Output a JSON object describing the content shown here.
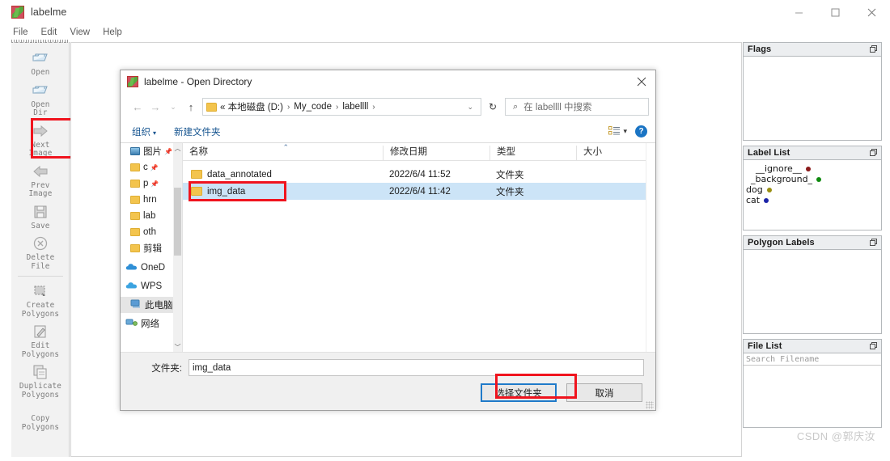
{
  "app": {
    "title": "labelme",
    "window_controls": [
      "minimize",
      "maximize",
      "close"
    ]
  },
  "menubar": {
    "items": [
      "File",
      "Edit",
      "View",
      "Help"
    ]
  },
  "toolbar": {
    "items": [
      {
        "label": "Open",
        "icon": "open-folder-icon"
      },
      {
        "label": "Open\nDir",
        "icon": "open-dir-folder-icon",
        "highlighted": true
      },
      {
        "label": "Next\nImage",
        "icon": "right-arrow-icon"
      },
      {
        "label": "Prev\nImage",
        "icon": "left-arrow-icon"
      },
      {
        "label": "Save",
        "icon": "floppy-disk-icon"
      },
      {
        "label": "Delete\nFile",
        "icon": "circle-x-icon"
      },
      {
        "label": "Create\nPolygons",
        "icon": "create-polygon-icon"
      },
      {
        "label": "Edit\nPolygons",
        "icon": "edit-polygon-icon"
      },
      {
        "label": "Duplicate\nPolygons",
        "icon": "duplicate-polygon-icon"
      },
      {
        "label": "Copy\nPolygons",
        "icon": "copy-polygon-icon"
      }
    ]
  },
  "dock": {
    "flags": {
      "title": "Flags",
      "float_icon": "float-panel-icon"
    },
    "label_list": {
      "title": "Label List",
      "float_icon": "float-panel-icon",
      "items": [
        {
          "text": "__ignore__",
          "color": "#8b1a1a"
        },
        {
          "text": "_background_",
          "color": "#0f8a0f"
        },
        {
          "text": "dog",
          "color": "#9a8f12"
        },
        {
          "text": "cat",
          "color": "#1b23a8"
        }
      ]
    },
    "polygon_labels": {
      "title": "Polygon Labels",
      "float_icon": "float-panel-icon"
    },
    "file_list": {
      "title": "File List",
      "float_icon": "float-panel-icon",
      "search_placeholder": "Search Filename"
    }
  },
  "watermark": "CSDN @郭庆汝",
  "dialog": {
    "title": "labelme - Open Directory",
    "close_icon": "close-icon",
    "nav": {
      "back_icon": "back-arrow-icon",
      "forward_icon": "forward-arrow-icon",
      "recent_icon": "chevron-down-icon",
      "up_icon": "up-arrow-icon",
      "refresh_icon": "refresh-icon",
      "breadcrumb": [
        "« 本地磁盘 (D:)",
        "My_code",
        "labellll",
        ""
      ],
      "breadcrumb_caret": "chevron-down-icon",
      "search_icon": "search-icon",
      "search_placeholder": "在 labellll 中搜索"
    },
    "commandbar": {
      "organize": "组织",
      "new_folder": "新建文件夹",
      "view_icon": "view-mode-icon",
      "view_caret": "chevron-down-icon",
      "help_icon": "help-icon",
      "help_label": "?"
    },
    "navpane": {
      "items": [
        {
          "label": "图片",
          "icon": "pictures-icon",
          "pinned": true
        },
        {
          "label": "c",
          "icon": "folder-icon",
          "pinned": true
        },
        {
          "label": "p",
          "icon": "folder-icon",
          "pinned": true
        },
        {
          "label": "hrn",
          "icon": "folder-icon",
          "pinned": false
        },
        {
          "label": "lab",
          "icon": "folder-icon",
          "pinned": false
        },
        {
          "label": "oth",
          "icon": "folder-icon",
          "pinned": false
        },
        {
          "label": "剪辑",
          "icon": "folder-icon",
          "pinned": false
        },
        {
          "label": "OneD",
          "icon": "onedrive-cloud-icon",
          "pinned": false
        },
        {
          "label": "WPS",
          "icon": "wps-cloud-icon",
          "pinned": false
        },
        {
          "label": "此电脑",
          "icon": "this-pc-icon",
          "pinned": false,
          "selected": true
        },
        {
          "label": "网络",
          "icon": "network-icon",
          "pinned": false
        }
      ],
      "scroll_up_icon": "chevron-up-icon",
      "scroll_down_icon": "chevron-down-icon"
    },
    "filelist": {
      "columns": [
        "名称",
        "修改日期",
        "类型",
        "大小"
      ],
      "sort_indicator": "ascending-caret-icon",
      "rows": [
        {
          "name": "data_annotated",
          "date": "2022/6/4 11:52",
          "type": "文件夹",
          "size": "",
          "selected": false
        },
        {
          "name": "img_data",
          "date": "2022/6/4 11:42",
          "type": "文件夹",
          "size": "",
          "selected": true,
          "highlighted": true
        }
      ]
    },
    "footer": {
      "folder_label": "文件夹:",
      "folder_value": "img_data",
      "choose_button": "选择文件夹",
      "cancel_button": "取消"
    },
    "highlight_color": "#f0141e",
    "accent_color": "#1f7ac9"
  }
}
